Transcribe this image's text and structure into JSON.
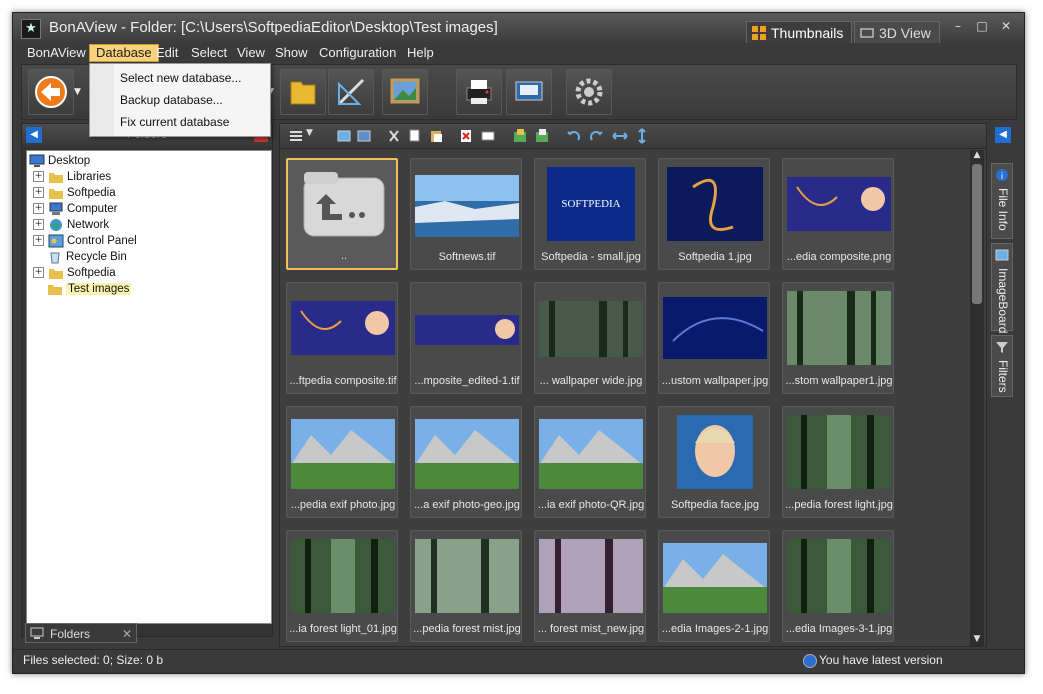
{
  "window": {
    "title": "BonAView - Folder: [C:\\Users\\SoftpediaEditor\\Desktop\\Test images]",
    "view_tabs": [
      "Thumbnails",
      "3D View"
    ],
    "controls": [
      "–",
      "□",
      "✕"
    ]
  },
  "menu": {
    "items": [
      "BonAView",
      "Database",
      "Edit",
      "Select",
      "View",
      "Show",
      "Configuration",
      "Help"
    ],
    "active": "Database",
    "dropdown": [
      "Select new database...",
      "Backup database...",
      "Fix current database"
    ]
  },
  "left_panel": {
    "title": "Folders",
    "tree": [
      {
        "label": "Desktop",
        "icon": "desktop-icon"
      },
      {
        "label": "Libraries",
        "icon": "folder-icon"
      },
      {
        "label": "Softpedia",
        "icon": "folder-icon"
      },
      {
        "label": "Computer",
        "icon": "computer-icon"
      },
      {
        "label": "Network",
        "icon": "network-icon"
      },
      {
        "label": "Control Panel",
        "icon": "control-panel-icon"
      },
      {
        "label": "Recycle Bin",
        "icon": "recycle-bin-icon"
      },
      {
        "label": "Softpedia",
        "icon": "folder-icon"
      },
      {
        "label": "Test images",
        "icon": "folder-icon"
      }
    ],
    "bottom_tab": "Folders"
  },
  "thumbnails": [
    "..",
    "Softnews.tif",
    "Softpedia  - small.jpg",
    "Softpedia 1.jpg",
    "...edia composite.png",
    "...ftpedia composite.tif",
    "...mposite_edited-1.tif",
    "... wallpaper wide.jpg",
    "...ustom wallpaper.jpg",
    "...stom wallpaper1.jpg",
    "...pedia exif photo.jpg",
    "...a exif photo-geo.jpg",
    "...ia exif photo-QR.jpg",
    "Softpedia face.jpg",
    "...pedia forest light.jpg",
    "...ia forest light_01.jpg",
    "...pedia forest mist.jpg",
    "... forest mist_new.jpg",
    "...edia Images-2-1.jpg",
    "...edia Images-3-1.jpg"
  ],
  "thumb_image_text": {
    "softpedia": "SOFTPEDIA"
  },
  "right_tabs": [
    "File Info",
    "ImageBoard",
    "Filters"
  ],
  "status": {
    "left": "Files selected: 0; Size: 0 b",
    "right": "You have latest version"
  },
  "colors": {
    "selection": "#f0c060",
    "accent": "#1e6fd1"
  }
}
